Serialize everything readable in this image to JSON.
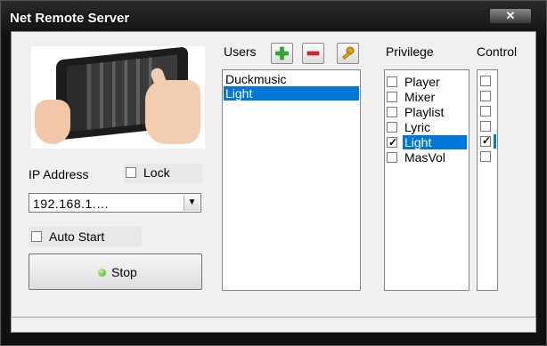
{
  "window": {
    "title": "Net Remote Server",
    "close_glyph": "✕"
  },
  "left": {
    "ip_label": "IP Address",
    "lock_label": "Lock",
    "lock_checked": false,
    "ip_value": "192.168.1.…",
    "autostart_label": "Auto Start",
    "autostart_checked": false,
    "stop_label": "Stop",
    "status_led_color": "#3fa61a"
  },
  "users": {
    "header": "Users",
    "add_icon": "plus-icon",
    "remove_icon": "minus-icon",
    "key_icon": "key-icon",
    "items": [
      "Duckmusic",
      "Light"
    ],
    "selected_index": 1
  },
  "privilege": {
    "header": "Privilege",
    "items": [
      {
        "label": "Player",
        "checked": false
      },
      {
        "label": "Mixer",
        "checked": false
      },
      {
        "label": "Playlist",
        "checked": false
      },
      {
        "label": "Lyric",
        "checked": false
      },
      {
        "label": "Light",
        "checked": true
      },
      {
        "label": "MasVol",
        "checked": false
      }
    ],
    "selected_index": 4
  },
  "control": {
    "header": "Control",
    "checked": [
      false,
      false,
      false,
      false,
      true,
      false
    ]
  },
  "colors": {
    "selection": "#0078d7",
    "add": "#2eae2e",
    "remove": "#e02424",
    "key": "#e0a010"
  }
}
